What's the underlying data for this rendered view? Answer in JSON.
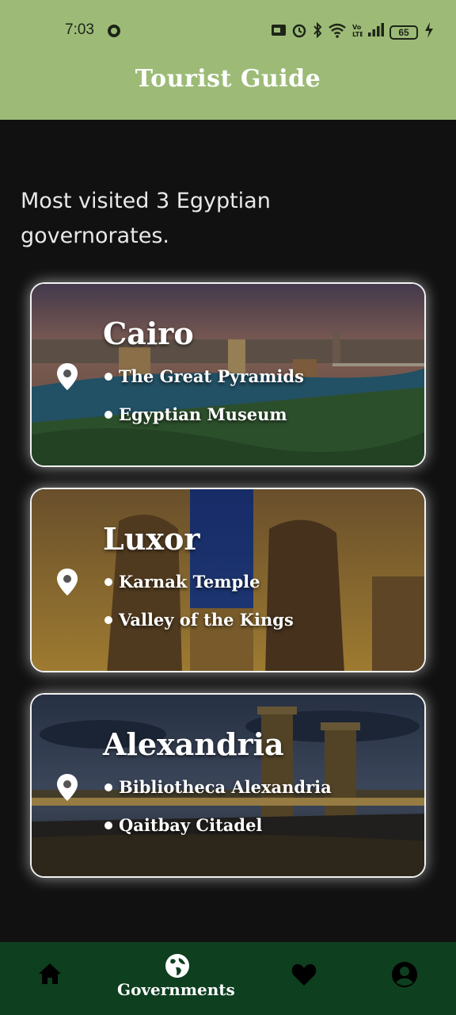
{
  "status_bar": {
    "time": "7:03",
    "battery": "65",
    "left_icons": [
      "whatsapp-icon"
    ],
    "right_icons": [
      "cast-icon",
      "alarm-icon",
      "bluetooth-icon",
      "wifi-icon",
      "volte-icon",
      "signal-icon",
      "battery-icon",
      "charging-icon"
    ]
  },
  "header": {
    "title": "Tourist Guide",
    "color": "#9dbb77"
  },
  "intro": {
    "line1": "Most visited 3 Egyptian",
    "line2": "governorates."
  },
  "cards": [
    {
      "title": "Cairo",
      "items": [
        "The Great Pyramids",
        "Egyptian Museum"
      ]
    },
    {
      "title": "Luxor",
      "items": [
        "Karnak Temple",
        "Valley of the Kings"
      ]
    },
    {
      "title": "Alexandria",
      "items": [
        "Bibliotheca Alexandria",
        "Qaitbay Citadel"
      ]
    }
  ],
  "bottom_nav": {
    "background": "#0e3f1f",
    "items": [
      {
        "icon": "home-icon",
        "label": ""
      },
      {
        "icon": "globe-icon",
        "label": "Governments",
        "selected": true
      },
      {
        "icon": "heart-icon",
        "label": ""
      },
      {
        "icon": "account-icon",
        "label": ""
      }
    ]
  }
}
